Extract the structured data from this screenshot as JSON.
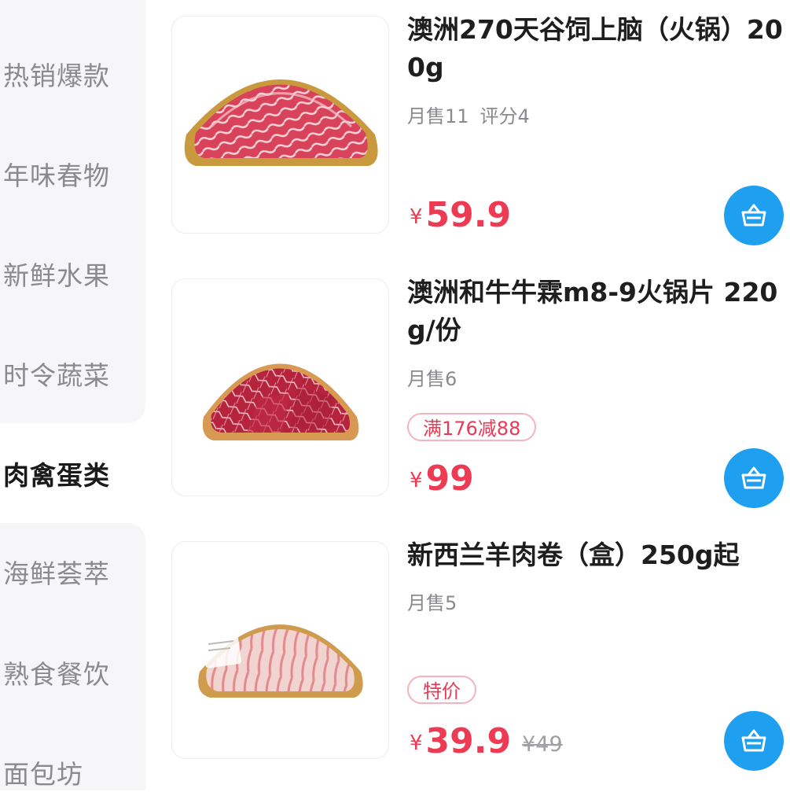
{
  "sidebar": {
    "items": [
      {
        "label": "热销爆款"
      },
      {
        "label": "年味春物"
      },
      {
        "label": "新鲜水果"
      },
      {
        "label": "时令蔬菜"
      },
      {
        "label": "肉禽蛋类",
        "active": true
      },
      {
        "label": "海鲜荟萃"
      },
      {
        "label": "熟食餐饮"
      },
      {
        "label": "面包坊"
      }
    ]
  },
  "products": [
    {
      "title": "澳洲270天谷饲上脑（火锅）200g",
      "monthly_sales": "月售11",
      "rating": "评分4",
      "currency": "¥",
      "price": "59.9",
      "image_icon": "beef-slices-tray"
    },
    {
      "title": "澳洲和牛牛霖m8-9火锅片 220g/份",
      "monthly_sales": "月售6",
      "tag": "满176减88",
      "currency": "¥",
      "price": "99",
      "image_icon": "wagyu-slices-tray"
    },
    {
      "title": "新西兰羊肉卷（盒）250g起",
      "monthly_sales": "月售5",
      "tag": "特价",
      "currency": "¥",
      "price": "39.9",
      "original_price": "¥49",
      "image_icon": "lamb-rolls-tray"
    }
  ],
  "colors": {
    "accent_blue": "#1f9ff0",
    "price_red": "#ee3b54",
    "sidebar_bg": "#f6f6f8"
  }
}
